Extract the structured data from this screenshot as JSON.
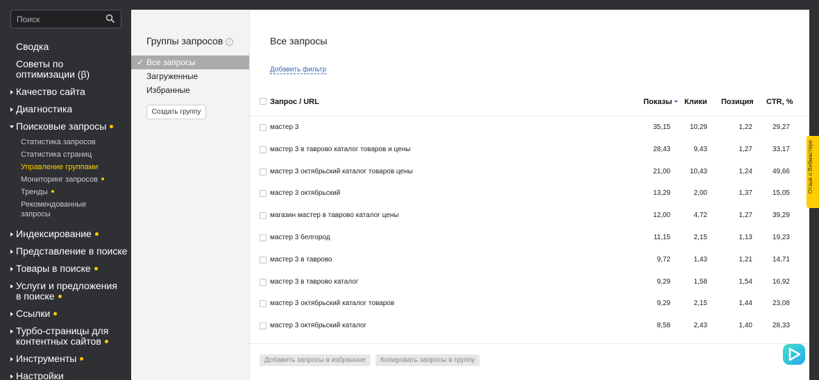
{
  "search": {
    "placeholder": "Поиск",
    "icon": "search-icon"
  },
  "sidebar": {
    "items": [
      {
        "label": "Сводка"
      },
      {
        "label": "Советы по оптимизации (β)"
      },
      {
        "label": "Качество сайта"
      },
      {
        "label": "Диагностика"
      },
      {
        "label": "Поисковые запросы"
      },
      {
        "label": "Индексирование"
      },
      {
        "label": "Представление в поиске"
      },
      {
        "label": "Товары в поиске"
      },
      {
        "label": "Услуги и предложения в поиске"
      },
      {
        "label": "Ссылки"
      },
      {
        "label": "Турбо-страницы для контентных сайтов"
      },
      {
        "label": "Инструменты"
      },
      {
        "label": "Настройки"
      }
    ],
    "subitems": [
      {
        "label": "Статистика запросов"
      },
      {
        "label": "Статистика страниц"
      },
      {
        "label": "Управление группами"
      },
      {
        "label": "Мониторинг запросов"
      },
      {
        "label": "Тренды"
      },
      {
        "label": "Рекомендованные запросы"
      }
    ],
    "accent_color": "#ffcc00"
  },
  "groups": {
    "title": "Группы запросов",
    "items": [
      {
        "label": "Все запросы"
      },
      {
        "label": "Загруженные"
      },
      {
        "label": "Избранные"
      }
    ],
    "create_label": "Создать группу"
  },
  "main": {
    "title": "Все запросы",
    "filter_label": "Добавить фильтр",
    "columns": {
      "query": "Запрос / URL",
      "shows": "Показы",
      "clicks": "Клики",
      "position": "Позиция",
      "ctr": "CTR, %"
    },
    "rows": [
      {
        "query": "мастер 3",
        "shows": "35,15",
        "clicks": "10,29",
        "position": "1,22",
        "ctr": "29,27"
      },
      {
        "query": "мастер 3 в таврово каталог товаров и цены",
        "shows": "28,43",
        "clicks": "9,43",
        "position": "1,27",
        "ctr": "33,17"
      },
      {
        "query": "мастер 3 октябрьский каталог товаров цены",
        "shows": "21,00",
        "clicks": "10,43",
        "position": "1,24",
        "ctr": "49,66"
      },
      {
        "query": "мастер 3 октябрьский",
        "shows": "13,29",
        "clicks": "2,00",
        "position": "1,37",
        "ctr": "15,05"
      },
      {
        "query": "магазин мастер в таврово каталог цены",
        "shows": "12,00",
        "clicks": "4,72",
        "position": "1,27",
        "ctr": "39,29"
      },
      {
        "query": "мастер 3 белгород",
        "shows": "11,15",
        "clicks": "2,15",
        "position": "1,13",
        "ctr": "19,23"
      },
      {
        "query": "мастер 3 в таврово",
        "shows": "9,72",
        "clicks": "1,43",
        "position": "1,21",
        "ctr": "14,71"
      },
      {
        "query": "мастер 3 в таврово каталог",
        "shows": "9,29",
        "clicks": "1,58",
        "position": "1,54",
        "ctr": "16,92"
      },
      {
        "query": "мастер 3 октябрьский каталог товаров",
        "shows": "9,29",
        "clicks": "2,15",
        "position": "1,44",
        "ctr": "23,08"
      },
      {
        "query": "мастер 3 октябрьский каталог",
        "shows": "8,58",
        "clicks": "2,43",
        "position": "1,40",
        "ctr": "28,33"
      }
    ],
    "footer": {
      "add_favorites": "Добавить запросы в избранное",
      "copy_to_group": "Копировать запросы в группу"
    }
  },
  "feedback": {
    "label": "Отзыв о Вебмастере"
  },
  "chat": {
    "icon": "chat-icon"
  }
}
